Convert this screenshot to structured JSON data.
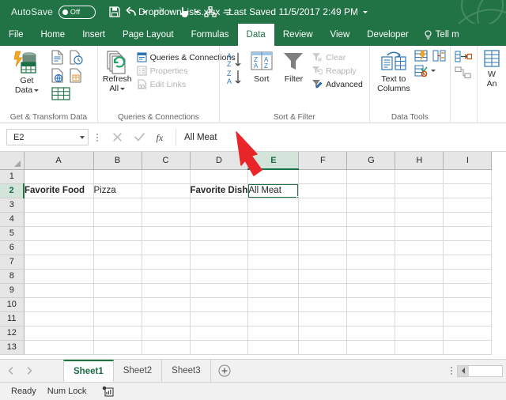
{
  "titlebar": {
    "autosave_label": "AutoSave",
    "autosave_state": "Off",
    "document_title": "DropdownLists.xlsx  -  Last Saved 11/5/2017 2:49 PM",
    "qat": [
      {
        "name": "save-icon",
        "label": "Save"
      },
      {
        "name": "undo-icon",
        "label": "Undo"
      },
      {
        "name": "redo-icon",
        "label": "Redo"
      },
      {
        "name": "touch-mouse-mode-icon",
        "label": "Touch/Mouse Mode"
      },
      {
        "name": "customize-quick-access-toolbar-icon",
        "label": "Customize Quick Access Toolbar"
      }
    ]
  },
  "ribbon_tabs": [
    {
      "label": "File",
      "active": false
    },
    {
      "label": "Home",
      "active": false
    },
    {
      "label": "Insert",
      "active": false
    },
    {
      "label": "Page Layout",
      "active": false
    },
    {
      "label": "Formulas",
      "active": false
    },
    {
      "label": "Data",
      "active": true
    },
    {
      "label": "Review",
      "active": false
    },
    {
      "label": "View",
      "active": false
    },
    {
      "label": "Developer",
      "active": false
    }
  ],
  "tellme": {
    "label": "Tell m"
  },
  "ribbon_groups": {
    "get_transform": {
      "label": "Get & Transform Data",
      "get_data": "Get\nData",
      "get_data_line1": "Get",
      "get_data_line2": "Data"
    },
    "queries_connections": {
      "label": "Queries & Connections",
      "items": [
        {
          "label": "Queries & Connections",
          "icon": "queries-connections-icon",
          "disabled": false
        },
        {
          "label": "Properties",
          "icon": "properties-icon",
          "disabled": true
        },
        {
          "label": "Edit Links",
          "icon": "edit-links-icon",
          "disabled": true
        }
      ],
      "refresh_all_line1": "Refresh",
      "refresh_all_line2": "All"
    },
    "sort_filter": {
      "label": "Sort & Filter",
      "sort_label": "Sort",
      "filter_label": "Filter",
      "items": [
        {
          "label": "Clear",
          "icon": "clear-filter-icon",
          "disabled": true
        },
        {
          "label": "Reapply",
          "icon": "reapply-filter-icon",
          "disabled": true
        },
        {
          "label": "Advanced",
          "icon": "advanced-filter-icon",
          "disabled": false
        }
      ]
    },
    "data_tools": {
      "label": "Data Tools",
      "text_to_columns_line1": "Text to",
      "text_to_columns_line2": "Columns"
    },
    "forecast": {
      "what_if_line1": "W",
      "what_if_line2": "An"
    }
  },
  "formula_bar": {
    "name_box_value": "E2",
    "cancel_label": "Cancel",
    "enter_label": "Enter",
    "insert_function_label": "fx",
    "formula_value": "All Meat"
  },
  "grid": {
    "columns": [
      "A",
      "B",
      "C",
      "D",
      "E",
      "F",
      "G",
      "H",
      "I"
    ],
    "selected_column": "E",
    "rows": [
      "1",
      "2",
      "3",
      "4",
      "5",
      "6",
      "7",
      "8",
      "9",
      "10",
      "11",
      "12",
      "13"
    ],
    "selected_row": "2",
    "cells": {
      "A2": "Favorite Food",
      "B2": "Pizza",
      "D2": "Favorite Dish",
      "E2": "All Meat"
    },
    "selected_cell": "E2"
  },
  "sheet_tabs": {
    "tabs": [
      {
        "label": "Sheet1",
        "active": true
      },
      {
        "label": "Sheet2",
        "active": false
      },
      {
        "label": "Sheet3",
        "active": false
      }
    ],
    "add_sheet_label": "+"
  },
  "status_bar": {
    "mode": "Ready",
    "num_lock": "Num Lock",
    "macro_record_label": "Record Macro"
  },
  "annotation": {
    "arrow_color": "#e8262a",
    "points_to": "formula-bar"
  }
}
